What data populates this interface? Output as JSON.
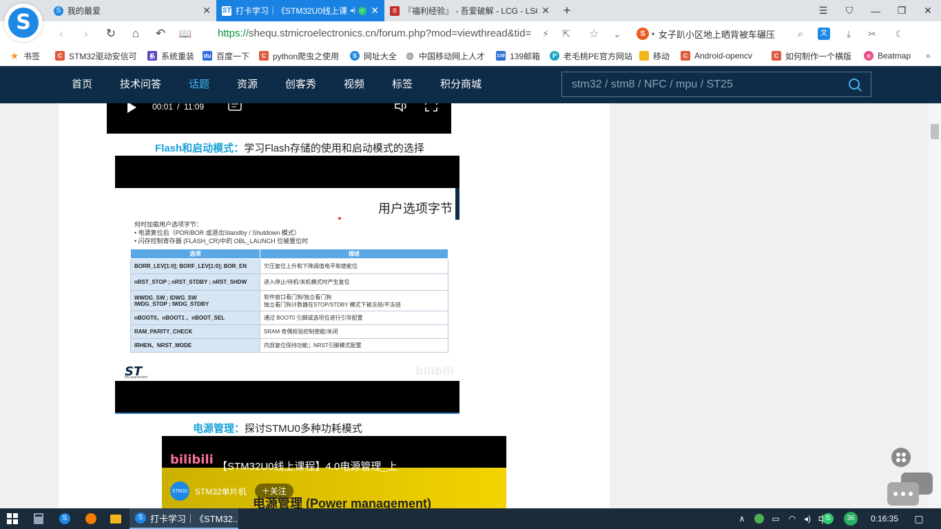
{
  "browser": {
    "tabs": [
      {
        "title": "我的最爱",
        "active": false
      },
      {
        "title": "打卡学习｜《STM32U0线上课程",
        "active": true
      },
      {
        "title": "『福利经验』 - 吾爱破解 - LCG - LSG",
        "active": false
      }
    ],
    "new_tab": "+",
    "url_scheme": "https://",
    "url_rest": "shequ.stmicroelectronics.cn/forum.php?mod=viewthread&tid=",
    "search_suggestion": "女子趴小区地上晒背被车碾压"
  },
  "bookmarks": [
    {
      "label": "书签",
      "icon": "star-icon",
      "color": "#f39c12"
    },
    {
      "label": "STM32驱动安信可",
      "icon": "csdn-icon",
      "color": "#e05a3b"
    },
    {
      "label": "系统重装",
      "icon": "system-icon",
      "color": "#5a3fbf"
    },
    {
      "label": "百度一下",
      "icon": "baidu-icon",
      "color": "#2d6be3"
    },
    {
      "label": "python爬虫之使用",
      "icon": "csdn-icon",
      "color": "#e05a3b"
    },
    {
      "label": "网址大全",
      "icon": "sogou-icon",
      "color": "#1e88e5"
    },
    {
      "label": "中国移动网上人才",
      "icon": "globe-icon",
      "color": "#555555"
    },
    {
      "label": "139邮箱",
      "icon": "mail-icon",
      "color": "#2c6fd6"
    },
    {
      "label": "老毛桃PE官方网站",
      "icon": "pe-icon",
      "color": "#1aa3c4"
    },
    {
      "label": "移动",
      "icon": "folder-icon",
      "color": "#f2b51a"
    },
    {
      "label": "Android-opencv",
      "icon": "csdn-icon",
      "color": "#e05a3b"
    },
    {
      "label": "如何制作一个横版",
      "icon": "csdn-icon",
      "color": "#e05a3b"
    },
    {
      "label": "Beatmap",
      "icon": "osu-icon",
      "color": "#e94b8a"
    }
  ],
  "site_nav": {
    "items": [
      "首页",
      "技术问答",
      "话题",
      "资源",
      "创客秀",
      "视频",
      "标签",
      "积分商城"
    ],
    "active_index": 2,
    "search_placeholder": "stm32 / stm8 / NFC / mpu / ST25"
  },
  "video1": {
    "current_time": "00:01",
    "separator": "/",
    "duration": "11:09"
  },
  "section_flash": {
    "keyword": "Flash和启动模式：",
    "text": "学习Flash存储的使用和启动模式的选择"
  },
  "slide": {
    "title": "用户选项字节",
    "intro": "何时加载用户选项字节：",
    "bullets": [
      "•   电源复位后（POR/BOR 或退出Standby / Shutdown 模式）",
      "•   闪存控制寄存器 (FLASH_CR)中的 OBL_LAUNCH 位被置位时"
    ],
    "table_headers": [
      "选项",
      "描述"
    ],
    "table_rows": [
      {
        "option": "BORR_LEV[1:0]; BORF_LEV[1:0]; BOR_EN",
        "desc": "欠压复位上升和下降阈值电平和使能位"
      },
      {
        "option": "nRST_STOP ; nRST_STDBY ;  nRST_SHDW",
        "desc": "进入停止/待机/关机模式时产生复位"
      },
      {
        "option": "WWDG_SW ; IDWG_SW\nIWDG_STOP ;  IWDG_STDBY",
        "desc": "软件窗口看门狗/独立看门狗\n独立看门狗计数器在STOP/STDBY 模式下被冻结/不冻结"
      },
      {
        "option": "nBOOT0、nBOOT1 、nBOOT_SEL",
        "desc": "通过 BOOT0 引脚或选项位进行引导配置"
      },
      {
        "option": "RAM_PARITY_CHECK",
        "desc": "SRAM 奇偶校验控制使能/关闭"
      },
      {
        "option": "IRHEN、NRST_MODE",
        "desc": "内部复位保持功能；NRST引脚模式配置"
      }
    ],
    "logo_text": "ST",
    "logo_sub": "life.augmented",
    "watermark": "bilibili"
  },
  "section_power": {
    "keyword": "电源管理：",
    "text": "探讨STMU0多种功耗模式"
  },
  "video2": {
    "brand": "bilibili",
    "title": "【STM32U0线上课程】4.0电源管理_上",
    "uploader": "STM32单片机",
    "uploader_avatar": "STM32",
    "follow": "＋关注",
    "overlay_text": "电源管理 (Power management)"
  },
  "taskbar": {
    "task_title": "打卡学习｜《STM32...",
    "ime": "中",
    "badge": "36",
    "clock": "0:16:35"
  },
  "colors": {
    "nav_bg": "#0e2b47",
    "nav_active": "#3fb8f0",
    "keyword": "#1aa0d8",
    "tab_active": "#1a82e2"
  }
}
